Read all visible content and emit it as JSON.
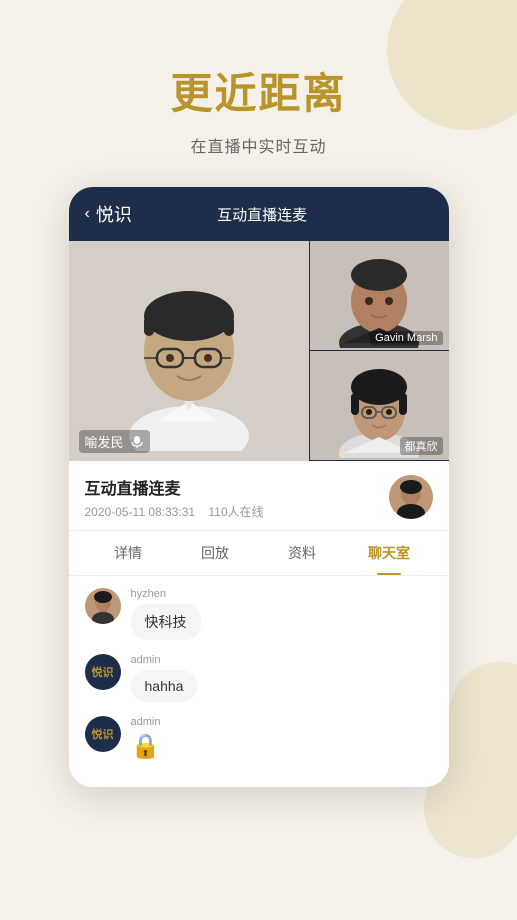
{
  "page": {
    "background_color": "#f5f0e8"
  },
  "hero": {
    "title": "更近距离",
    "subtitle": "在直播中实时互动"
  },
  "app": {
    "header": {
      "back_label": "悦识",
      "title": "互动直播连麦"
    },
    "video": {
      "main_user": "喻发民",
      "side_users": [
        "Gavin Marsh",
        "都真欣"
      ]
    },
    "stream": {
      "title": "互动直播连麦",
      "date": "2020-05-11 08:33:31",
      "viewers": "110人在线"
    },
    "tabs": [
      {
        "label": "详情",
        "active": false
      },
      {
        "label": "回放",
        "active": false
      },
      {
        "label": "资料",
        "active": false
      },
      {
        "label": "聊天室",
        "active": true
      }
    ],
    "chat": [
      {
        "username": "hyzhen",
        "message": "快科技",
        "avatar_type": "photo",
        "brand": false
      },
      {
        "username": "admin",
        "message": "hahha",
        "avatar_type": "brand",
        "brand": true
      },
      {
        "username": "admin",
        "message": "🔒",
        "avatar_type": "brand",
        "brand": true
      }
    ]
  }
}
